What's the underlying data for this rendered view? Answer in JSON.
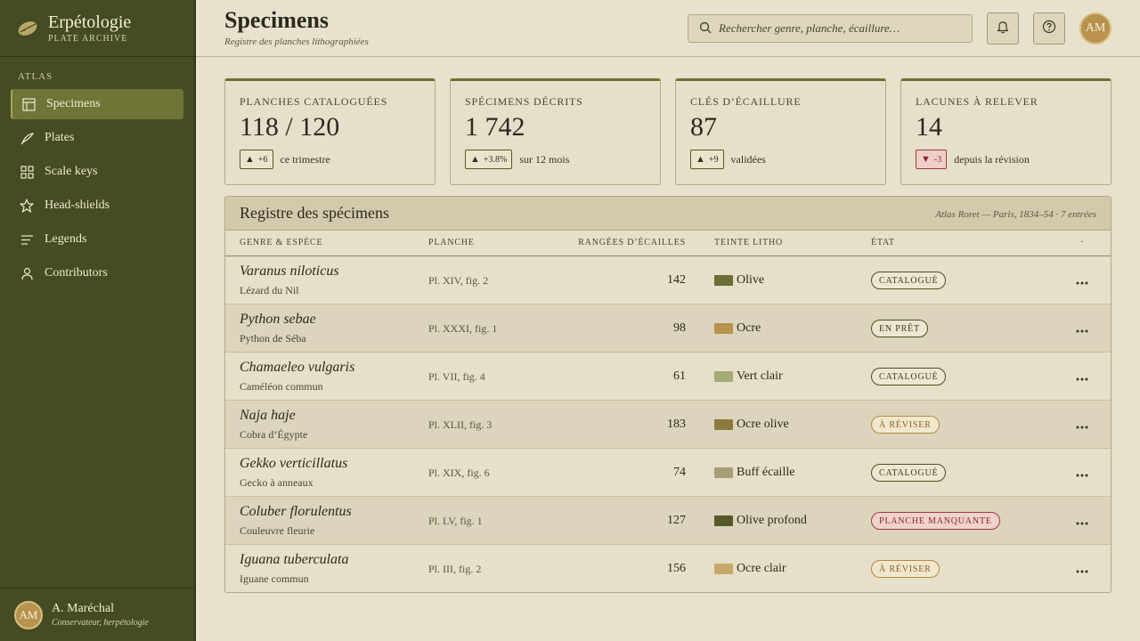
{
  "brand": {
    "title": "Erpétologie",
    "subtitle": "PLATE ARCHIVE"
  },
  "sidebar": {
    "section": "ATLAS",
    "items": [
      {
        "label": "Specimens",
        "icon": "table-icon",
        "active": true
      },
      {
        "label": "Plates",
        "icon": "quill-icon"
      },
      {
        "label": "Scale keys",
        "icon": "grid-icon"
      },
      {
        "label": "Head-shields",
        "icon": "star-icon"
      },
      {
        "label": "Legends",
        "icon": "lines-icon"
      },
      {
        "label": "Contributors",
        "icon": "person-icon"
      }
    ]
  },
  "user": {
    "initials": "AM",
    "name": "A. Maréchal",
    "role": "Conservateur, herpétologie"
  },
  "header": {
    "title": "Specimens",
    "subtitle": "Registre des planches lithographiées",
    "search_placeholder": "Rechercher genre, planche, écaillure…",
    "avatar_initials": "AM"
  },
  "kpis": [
    {
      "label": "PLANCHES CATALOGUÉES",
      "value": "118 / 120",
      "delta": "+6",
      "trend": "up",
      "note": "ce trimestre"
    },
    {
      "label": "SPÉCIMENS DÉCRITS",
      "value": "1 742",
      "delta": "+3.8%",
      "trend": "up",
      "note": "sur 12 mois"
    },
    {
      "label": "CLÉS D’ÉCAILLURE",
      "value": "87",
      "delta": "+9",
      "trend": "up",
      "note": "validées"
    },
    {
      "label": "LACUNES À RELEVER",
      "value": "14",
      "delta": "-3",
      "trend": "down",
      "note": "depuis la révision"
    }
  ],
  "table": {
    "title": "Registre des spécimens",
    "meta": "Atlas Roret — Paris, 1834–54 · 7 entrées",
    "columns": {
      "species": "GENRE & ESPÈCE",
      "plate": "PLANCHE",
      "rows": "RANGÉES D’ÉCAILLES",
      "tint": "TEINTE LITHO",
      "status": "ÉTAT",
      "actions": "·"
    },
    "rows": [
      {
        "name": "Varanus niloticus",
        "common": "Lézard du Nil",
        "plate": "Pl. XIV, fig. 2",
        "scale_rows": "142",
        "tint": "Olive",
        "tint_color": "#6b6e36",
        "status": "CATALOGUÉ",
        "status_kind": "ok"
      },
      {
        "name": "Python sebae",
        "common": "Python de Séba",
        "plate": "Pl. XXXI, fig. 1",
        "scale_rows": "98",
        "tint": "Ocre",
        "tint_color": "#b8924e",
        "status": "EN PRÊT",
        "status_kind": "loan"
      },
      {
        "name": "Chamaeleo vulgaris",
        "common": "Caméléon commun",
        "plate": "Pl. VII, fig. 4",
        "scale_rows": "61",
        "tint": "Vert clair",
        "tint_color": "#a4ab74",
        "status": "CATALOGUÉ",
        "status_kind": "ok"
      },
      {
        "name": "Naja haje",
        "common": "Cobra d’Égypte",
        "plate": "Pl. XLII, fig. 3",
        "scale_rows": "183",
        "tint": "Ocre olive",
        "tint_color": "#8a7b3c",
        "status": "À RÉVISER",
        "status_kind": "warn"
      },
      {
        "name": "Gekko verticillatus",
        "common": "Gecko à anneaux",
        "plate": "Pl. XIX, fig. 6",
        "scale_rows": "74",
        "tint": "Buff écaille",
        "tint_color": "#a79d77",
        "status": "CATALOGUÉ",
        "status_kind": "ok"
      },
      {
        "name": "Coluber florulentus",
        "common": "Couleuvre fleurie",
        "plate": "Pl. LV, fig. 1",
        "scale_rows": "127",
        "tint": "Olive profond",
        "tint_color": "#555a28",
        "status": "PLANCHE MANQUANTE",
        "status_kind": "missing"
      },
      {
        "name": "Iguana tuberculata",
        "common": "Iguane commun",
        "plate": "Pl. III, fig. 2",
        "scale_rows": "156",
        "tint": "Ocre clair",
        "tint_color": "#c9a96a",
        "status": "À RÉVISER",
        "status_kind": "warn"
      }
    ]
  },
  "colors": {
    "sidebar": "#454b22",
    "active": "#6f7537",
    "accent": "#6f7132",
    "page": "#e8e1cd"
  }
}
